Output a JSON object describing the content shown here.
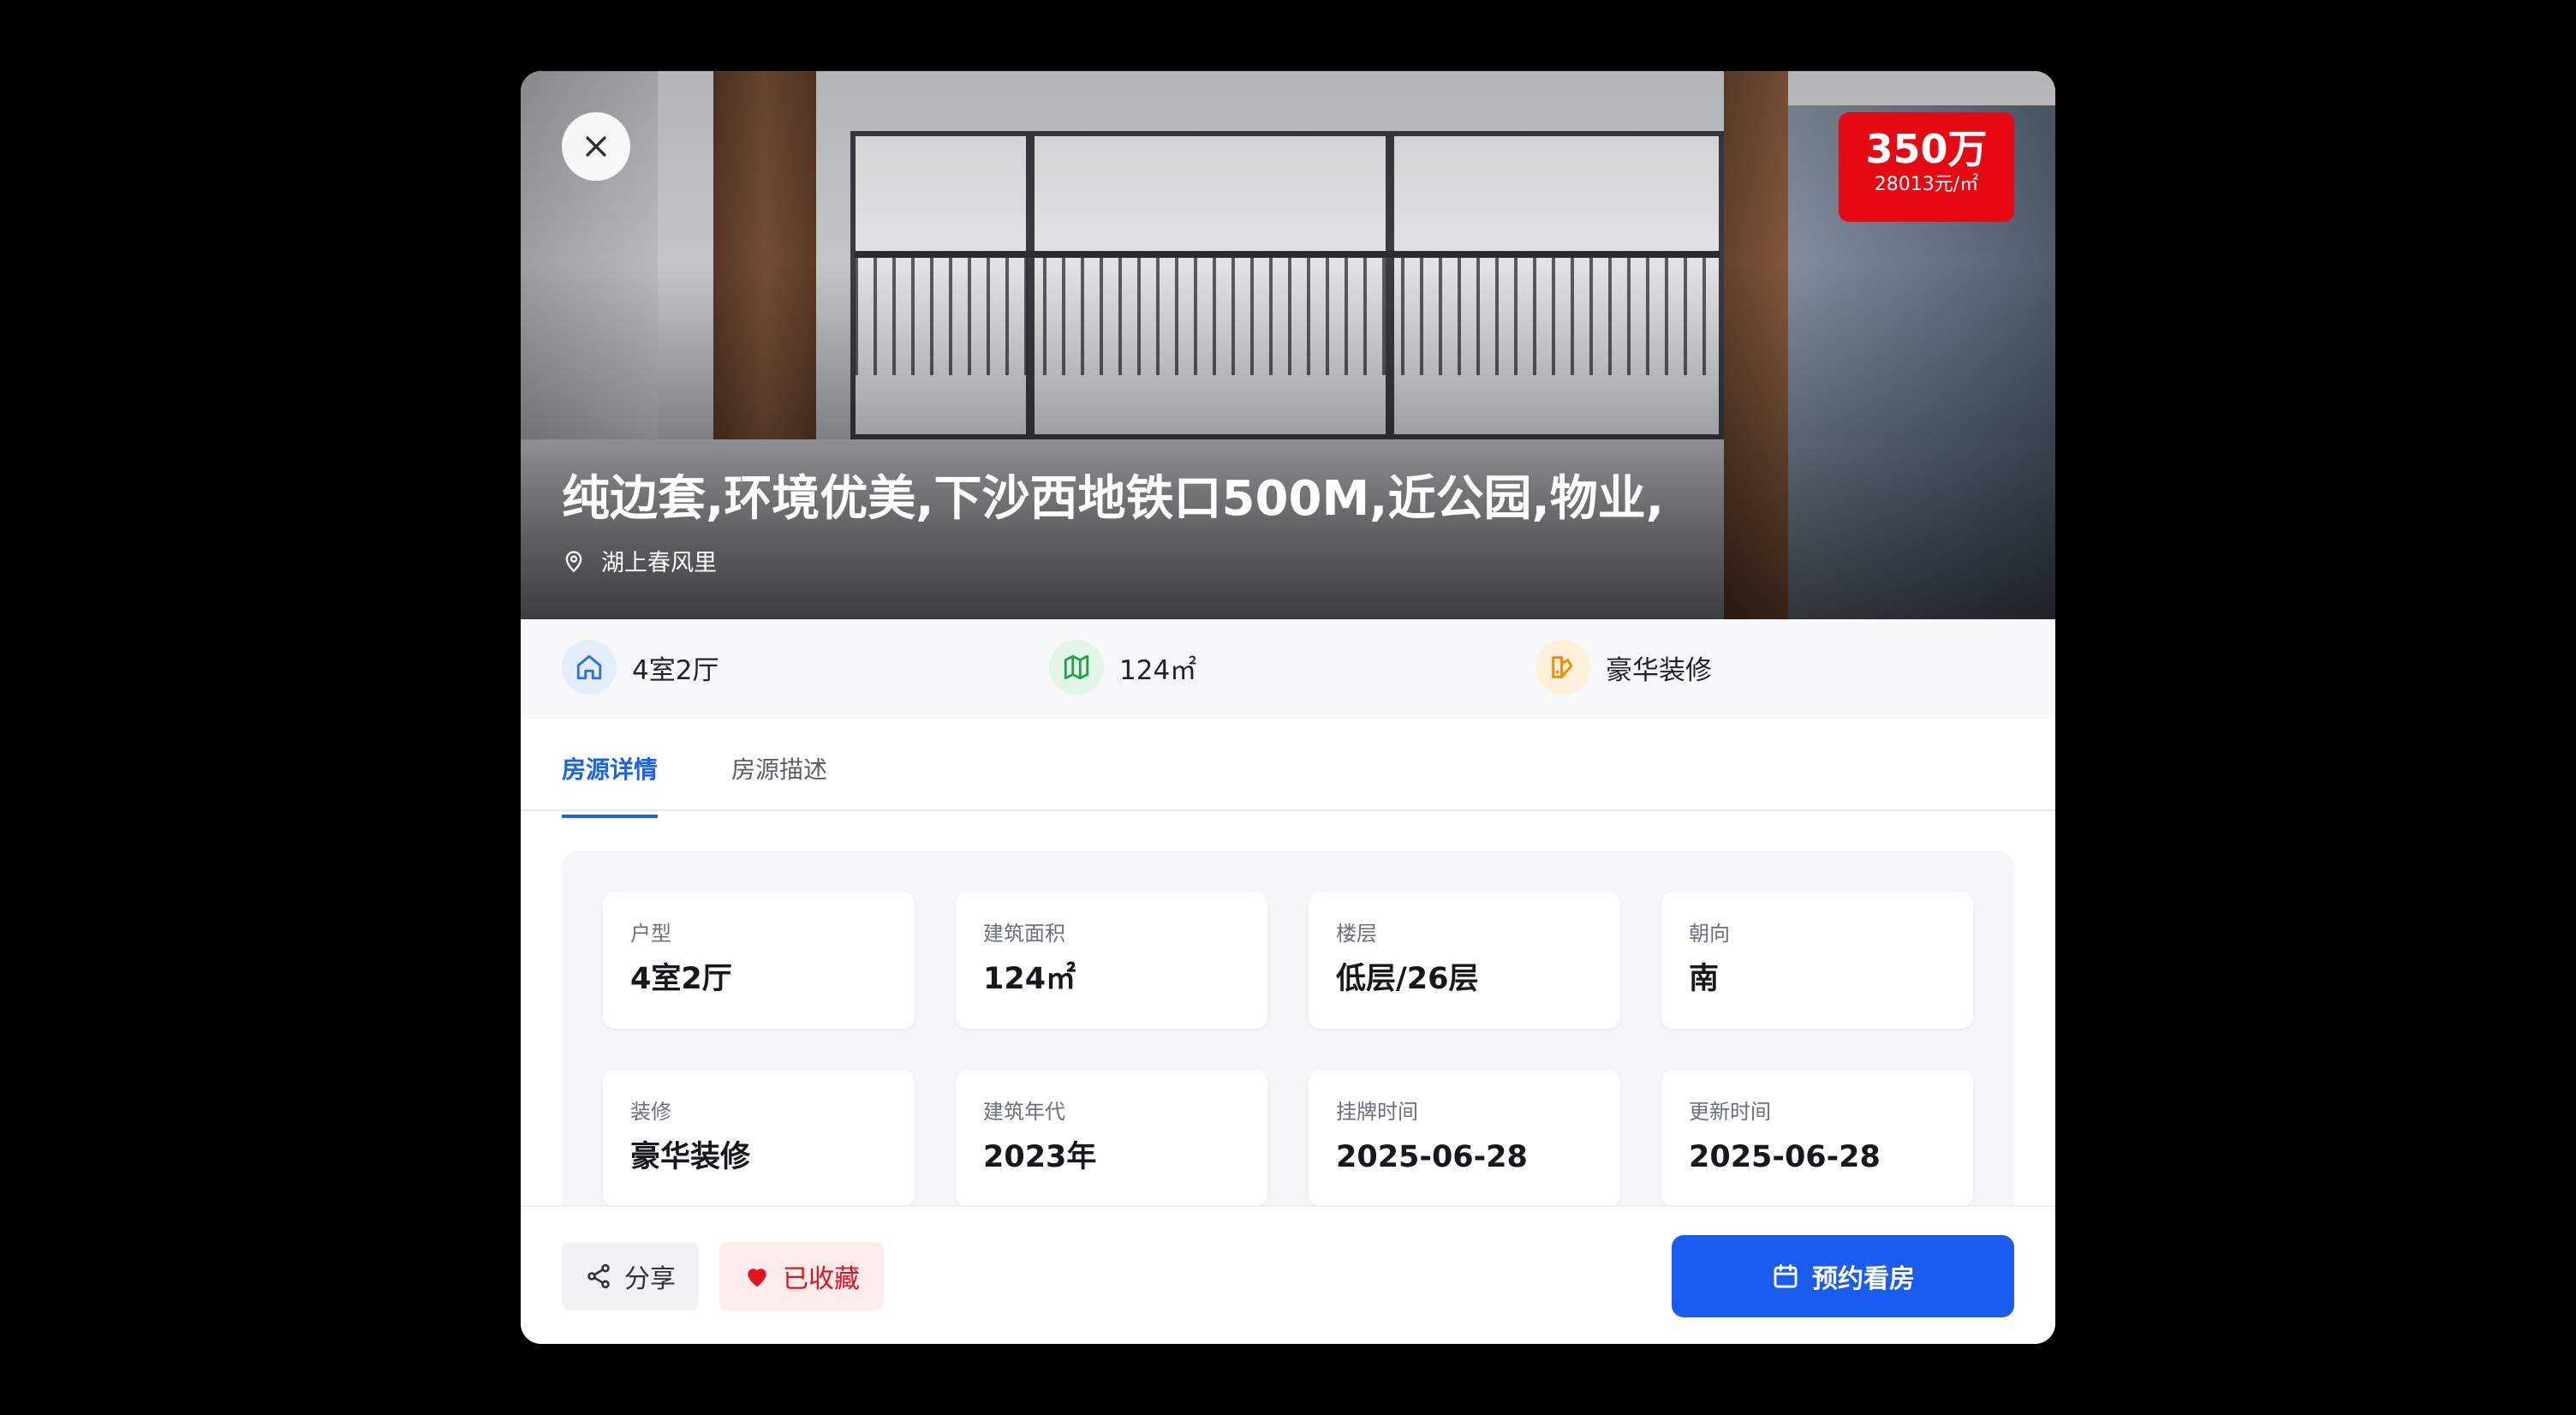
{
  "listing": {
    "title": "纯边套,环境优美,下沙西地铁口500M,近公园,物业,",
    "location": "湖上春风里",
    "price": "350万",
    "unit_price": "28013元/㎡"
  },
  "features": [
    {
      "icon": "home-icon",
      "label": "4室2厅",
      "color": "#2f6fe0",
      "bg": "#e3edfc"
    },
    {
      "icon": "map-icon",
      "label": "124㎡",
      "color": "#22a04b",
      "bg": "#e3f5e8"
    },
    {
      "icon": "paint-icon",
      "label": "豪华装修",
      "color": "#f08a00",
      "bg": "#fff1d9"
    }
  ],
  "tabs": [
    {
      "label": "房源详情",
      "active": true
    },
    {
      "label": "房源描述",
      "active": false
    }
  ],
  "details": [
    {
      "label": "户型",
      "value": "4室2厅"
    },
    {
      "label": "建筑面积",
      "value": "124㎡"
    },
    {
      "label": "楼层",
      "value": "低层/26层"
    },
    {
      "label": "朝向",
      "value": "南"
    },
    {
      "label": "装修",
      "value": "豪华装修"
    },
    {
      "label": "建筑年代",
      "value": "2023年"
    },
    {
      "label": "挂牌时间",
      "value": "2025-06-28"
    },
    {
      "label": "更新时间",
      "value": "2025-06-28"
    }
  ],
  "footer": {
    "share_label": "分享",
    "favorite_label": "已收藏",
    "book_label": "预约看房"
  },
  "colors": {
    "accent": "#1a5cf0",
    "price_badge": "#e50914",
    "favorite": "#e0141e"
  }
}
